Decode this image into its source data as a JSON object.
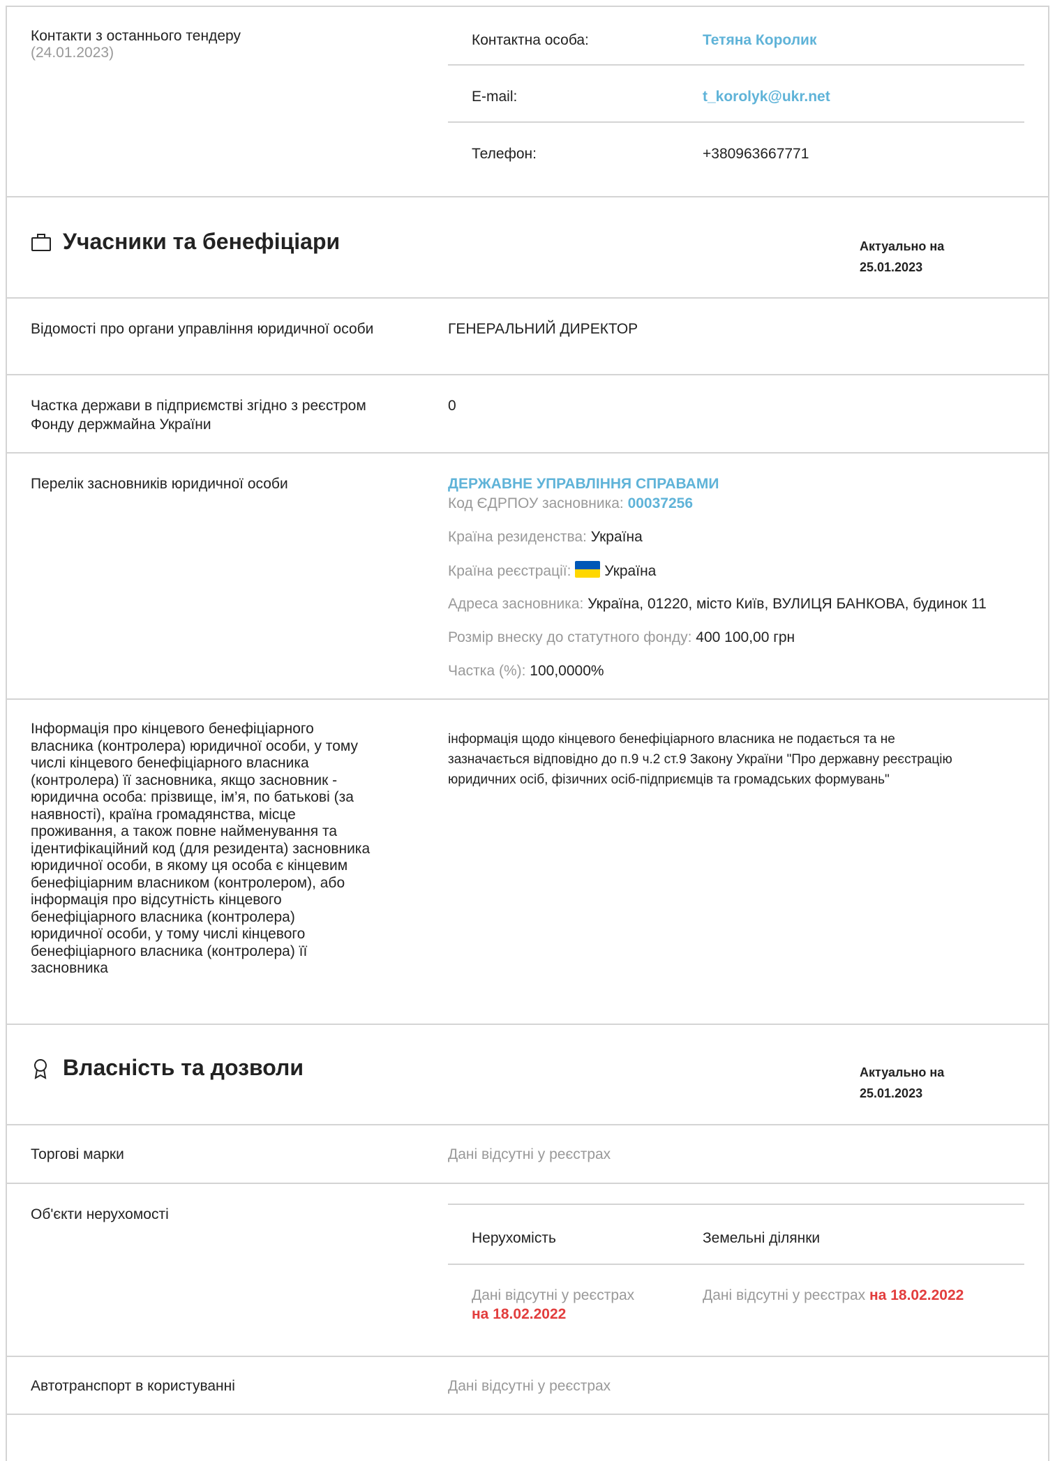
{
  "contacts": {
    "label": "Контакти з останнього тендеру",
    "date": "(24.01.2023)",
    "person_label": "Контактна особа:",
    "person_value": "Тетяна Королик",
    "email_label": "E-mail:",
    "email_value": "t_korolyk@ukr.net",
    "phone_label": "Телефон:",
    "phone_value": "+380963667771"
  },
  "participants": {
    "title": "Учасники та бенефіціари",
    "actual_label": "Актуально на",
    "actual_date": "25.01.2023",
    "governance_label": "Відомості про органи управління юридичної особи",
    "governance_value": "ГЕНЕРАЛЬНИЙ ДИРЕКТОР",
    "state_share_label": "Частка держави в підприємстві згідно з реєстром Фонду держмайна України",
    "state_share_value": "0",
    "founders_label": "Перелік засновників юридичної особи",
    "founder": {
      "name": "ДЕРЖАВНЕ УПРАВЛІННЯ СПРАВАМИ",
      "code_label": "Код ЄДРПОУ засновника:",
      "code_value": "00037256",
      "residence_label": "Країна резиденства:",
      "residence_value": "Україна",
      "registration_label": "Країна реєстрації:",
      "registration_value": "Україна",
      "address_label": "Адреса засновника:",
      "address_value": "Україна, 01220, місто Київ, ВУЛИЦЯ БАНКОВА, будинок 11",
      "contribution_label": "Розмір внеску до статутного фонду:",
      "contribution_value": "400 100,00 грн",
      "share_label": "Частка (%):",
      "share_value": "100,0000%"
    },
    "beneficiary_label_lines": [
      "Інформація про кінцевого бенефіціарного",
      "власника (контролера) юридичної особи, у тому",
      "числі кінцевого бенефіціарного власника",
      "(контролера) її засновника, якщо засновник -",
      "юридична особа: прізвище, ім’я, по батькові (за",
      "наявності), країна громадянства, місце",
      "проживання, а також повне найменування та",
      "ідентифікаційний код (для резидента) засновника",
      "юридичної особи, в якому ця особа є кінцевим",
      "бенефіціарним власником (контролером), або",
      "інформація про відсутність кінцевого",
      "бенефіціарного власника (контролера)",
      "юридичної особи, у тому числі кінцевого",
      "бенефіціарного власника (контролера) її",
      "засновника"
    ],
    "beneficiary_value_lines": [
      "інформація щодо кінцевого бенефіціарного власника не подається та не",
      "зазначається відповідно до п.9 ч.2 ст.9 Закону України \"Про державну реєстрацію",
      "юридичних осіб, фізичних осіб-підприємців та громадських формувань\""
    ]
  },
  "property": {
    "title": "Власність та дозволи",
    "actual_label": "Актуально на",
    "actual_date": "25.01.2023",
    "trademarks_label": "Торгові марки",
    "trademarks_value": "Дані відсутні у реєстрах",
    "realestate_label": "Об'єкти нерухомості",
    "tab_realestate": "Нерухомість",
    "tab_land": "Земельні ділянки",
    "realestate_none": "Дані відсутні у реєстрах",
    "realestate_date": "на 18.02.2022",
    "land_none": "Дані відсутні у реєстрах",
    "land_date": "на 18.02.2022",
    "vehicles_label": "Автотранспорт в користуванні",
    "vehicles_value": "Дані відсутні у реєстрах"
  },
  "colors": {
    "link": "#5fb3d8",
    "alert": "#e23d3d",
    "muted": "#999999",
    "flag_blue": "#0057b7",
    "flag_yellow": "#ffd700"
  },
  "icons": {
    "participants": "briefcase-icon",
    "property": "award-icon"
  }
}
